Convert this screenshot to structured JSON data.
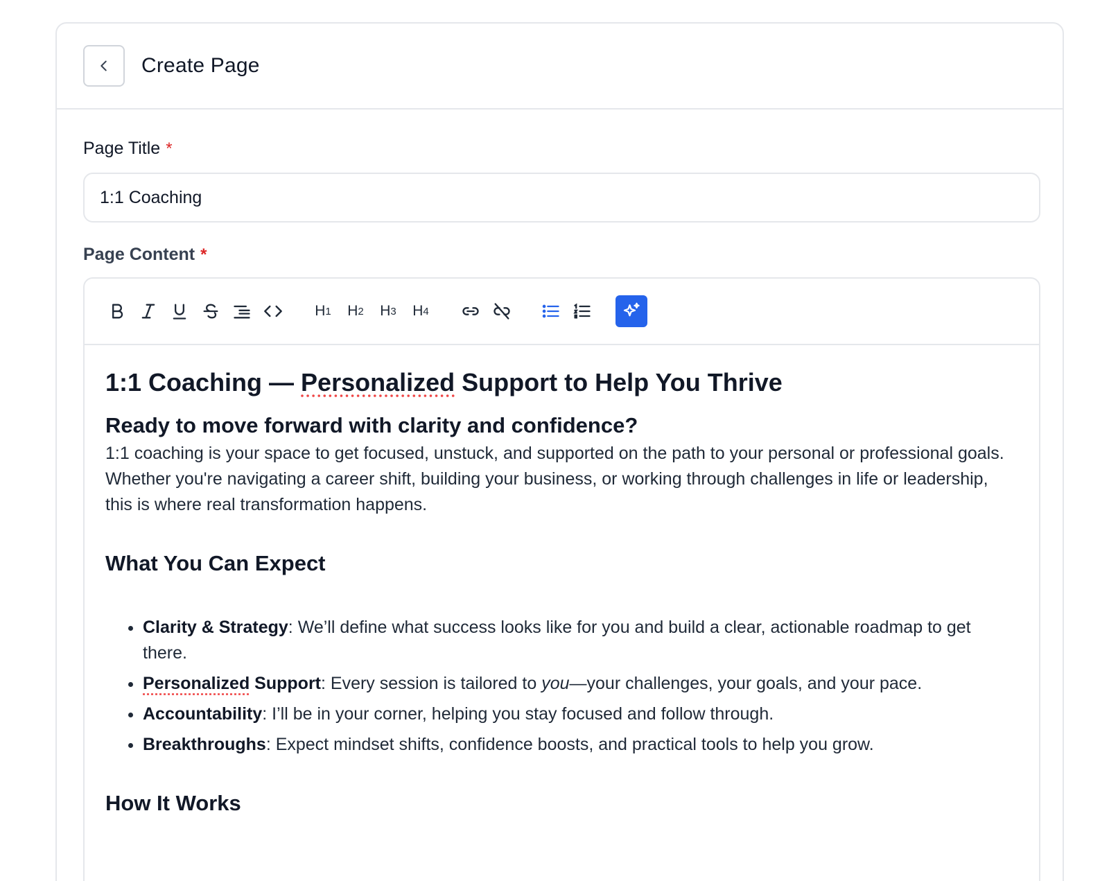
{
  "header": {
    "title": "Create Page"
  },
  "form": {
    "title_label": "Page Title",
    "required_mark": "*",
    "title_value": "1:1 Coaching",
    "content_label": "Page Content"
  },
  "toolbar": {
    "h1": "H",
    "h1_sub": "1",
    "h2": "H",
    "h2_sub": "2",
    "h3": "H",
    "h3_sub": "3",
    "h4": "H",
    "h4_sub": "4",
    "active_color": "#2563eb"
  },
  "content": {
    "heading_prefix": "1:1 Coaching — ",
    "heading_spell": "Personalized",
    "heading_suffix": " Support to Help You Thrive",
    "subheading": "Ready to move forward with clarity and confidence?",
    "intro": "1:1 coaching is your space to get focused, unstuck, and supported on the path to your personal or professional goals. Whether you're navigating a career shift, building your business, or working through challenges in life or leadership, this is where real transformation happens.",
    "expect_heading": "What You Can Expect",
    "bullets": [
      {
        "bold": "Clarity & Strategy",
        "text": ": We’ll define what success looks like for you and build a clear, actionable roadmap to get there."
      },
      {
        "bold_spell": "Personalized",
        "bold_rest": " Support",
        "text_a": ": Every session is tailored to ",
        "italic": "you",
        "text_b": "—your challenges, your goals, and your pace."
      },
      {
        "bold": "Accountability",
        "text": ": I’ll be in your corner, helping you stay focused and follow through."
      },
      {
        "bold": "Breakthroughs",
        "text": ": Expect mindset shifts, confidence boosts, and practical tools to help you grow."
      }
    ],
    "how_heading": "How It Works"
  }
}
